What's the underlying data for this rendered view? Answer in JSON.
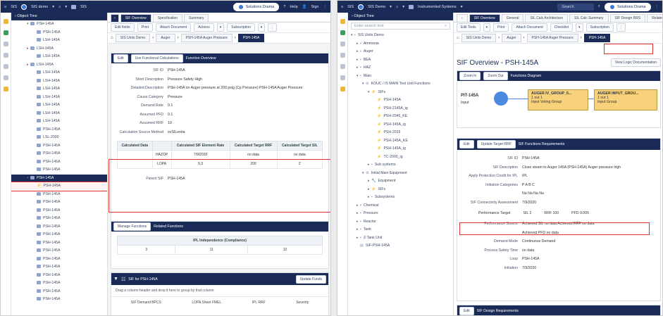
{
  "left": {
    "topbar": {
      "app_menu": "SIS",
      "project": "SIS demo",
      "home_caret": "▾",
      "unit": "SIS",
      "brand": "Solutions Drama",
      "help": "Help",
      "user": "Sign",
      "more": "⋮"
    },
    "tree": {
      "header": "Object Tree",
      "items": [
        {
          "label": "PSH-145A",
          "level": 2,
          "toggle": "▾",
          "state": ""
        },
        {
          "label": "PSH-145A",
          "level": 3,
          "toggle": "",
          "state": ""
        },
        {
          "label": "LSH-145A",
          "level": 3,
          "toggle": "",
          "state": ""
        },
        {
          "label": "LSH-145A",
          "level": 2,
          "toggle": "▸",
          "state": ""
        },
        {
          "label": "LSH-145A",
          "level": 3,
          "toggle": "",
          "state": ""
        },
        {
          "label": "LSH-145A",
          "level": 2,
          "toggle": "▸",
          "state": ""
        },
        {
          "label": "LSH-145A",
          "level": 3,
          "toggle": "",
          "state": ""
        },
        {
          "label": "LSH-145A",
          "level": 3,
          "toggle": "",
          "state": ""
        },
        {
          "label": "LSH-145A",
          "level": 3,
          "toggle": "",
          "state": ""
        },
        {
          "label": "LSH-145A",
          "level": 3,
          "toggle": "",
          "state": ""
        },
        {
          "label": "LSH-145A",
          "level": 3,
          "toggle": "",
          "state": ""
        },
        {
          "label": "LSH-145A",
          "level": 3,
          "toggle": "",
          "state": ""
        },
        {
          "label": "LSH-145A",
          "level": 3,
          "toggle": "",
          "state": ""
        },
        {
          "label": "PSH-145A",
          "level": 3,
          "toggle": "",
          "state": ""
        },
        {
          "label": "LSL-2000",
          "level": 3,
          "toggle": "",
          "state": ""
        },
        {
          "label": "PSH-145A",
          "level": 3,
          "toggle": "",
          "state": ""
        },
        {
          "label": "PSH-145A",
          "level": 3,
          "toggle": "",
          "state": ""
        },
        {
          "label": "PSH-145A",
          "level": 3,
          "toggle": "",
          "state": ""
        },
        {
          "label": "PSH-145A",
          "level": 3,
          "toggle": "",
          "state": ""
        },
        {
          "label": "PSH-145A",
          "level": 2,
          "toggle": "▾",
          "state": "sel"
        },
        {
          "label": "PSH-145A",
          "level": 3,
          "toggle": "",
          "state": "hl"
        },
        {
          "label": "PSH-145A",
          "level": 3,
          "toggle": "",
          "state": ""
        },
        {
          "label": "PSH-145A",
          "level": 3,
          "toggle": "",
          "state": ""
        },
        {
          "label": "PSH-145A",
          "level": 3,
          "toggle": "",
          "state": ""
        },
        {
          "label": "PSH-145A",
          "level": 3,
          "toggle": "",
          "state": ""
        },
        {
          "label": "PSH-145A",
          "level": 3,
          "toggle": "",
          "state": ""
        },
        {
          "label": "PSH-145A",
          "level": 3,
          "toggle": "",
          "state": ""
        },
        {
          "label": "PSH-145A",
          "level": 3,
          "toggle": "",
          "state": ""
        },
        {
          "label": "PSH-145A",
          "level": 3,
          "toggle": "",
          "state": ""
        },
        {
          "label": "PSH-145A",
          "level": 3,
          "toggle": "",
          "state": ""
        },
        {
          "label": "PSH-145A",
          "level": 3,
          "toggle": "",
          "state": ""
        },
        {
          "label": "PSH-145A",
          "level": 3,
          "toggle": "",
          "state": ""
        },
        {
          "label": "PSH-145A",
          "level": 3,
          "toggle": "",
          "state": ""
        },
        {
          "label": "PSH-145A",
          "level": 3,
          "toggle": "",
          "state": ""
        },
        {
          "label": "PSH-145A",
          "level": 3,
          "toggle": "",
          "state": ""
        }
      ]
    },
    "tabs": [
      "SIF Overview",
      "Specification",
      "Summary"
    ],
    "toolbar": {
      "edit": "Edit fields",
      "print": "Print",
      "attach": "Attach Document",
      "actions": "Actions",
      "subscription": "Subscription"
    },
    "crumbs": [
      "SIS Units Demo",
      "Auger",
      "PSH-145A Auger Pressure",
      "PSH-145A"
    ],
    "card1": {
      "buttons": [
        "Edit",
        "Use Functional Calculations"
      ],
      "title": "Function Overview",
      "fields": [
        {
          "k": "SIF ID",
          "v": "PSH-145A"
        },
        {
          "k": "Short Description",
          "v": "Pressure Safety High"
        },
        {
          "k": "Detailed Description",
          "v": "PSH-145A on Auger pressure at 200 psig (Cp Pressure) PSH-145A Auger Pressure"
        },
        {
          "k": "Cause Category",
          "v": "Pressure"
        },
        {
          "k": "Demand Rate",
          "v": "0.1"
        },
        {
          "k": "Assumed PFD",
          "v": "0.1"
        },
        {
          "k": "Assumed RRF",
          "v": "10"
        },
        {
          "k": "Calculation Source Method",
          "v": "exSILentia"
        }
      ],
      "table": {
        "headers": [
          "Calculated Data",
          "",
          "Calculated SIF Element Rate",
          "Calculated Target RRF",
          "Calculated Target SIL"
        ],
        "rows": [
          [
            "",
            "HAZOP",
            "7/9/2020",
            "no data",
            "no data"
          ],
          [
            "",
            "LOPA",
            "6.3",
            "200",
            "2"
          ]
        ]
      },
      "footer": {
        "k": "Parent SIF",
        "v": "PSH-145A"
      }
    },
    "card2": {
      "buttons": [
        "Manage Functions",
        "Related Functions"
      ],
      "table_title": "IPL Independence (Compliance)",
      "cells": [
        "3",
        "11",
        "12"
      ]
    },
    "card3": {
      "title": "SIF for PSH-145A",
      "button": "Update Funds",
      "hint": "Drag a column header and drop it here to group by that column",
      "cols": [
        "SIF Demand BPCS",
        "LOPA Sheet FMEL",
        "IPL RRF",
        "Severity"
      ]
    }
  },
  "right": {
    "topbar": {
      "app_menu": "SIS",
      "project": "SIS Demo",
      "unit": "Instrumented Systems",
      "search": "Search",
      "brand": "Solutions Drama",
      "more": "⋮"
    },
    "tree": {
      "header": "Object Tree",
      "search": "Enter search text",
      "items": [
        {
          "label": "SIS Units Demo",
          "level": 0,
          "toggle": "▾",
          "icon": "folder"
        },
        {
          "label": "Ammonia",
          "level": 1,
          "toggle": "▸",
          "icon": "folder"
        },
        {
          "label": "Auger",
          "level": 1,
          "toggle": "▸",
          "icon": "folder"
        },
        {
          "label": "BEA",
          "level": 1,
          "toggle": "▸",
          "icon": "folder"
        },
        {
          "label": "HAZ",
          "level": 1,
          "toggle": "▸",
          "icon": "folder"
        },
        {
          "label": "Main",
          "level": 1,
          "toggle": "▾",
          "icon": "folder"
        },
        {
          "label": "KOUC / IS MAIN Test Unit Functions",
          "level": 2,
          "toggle": "▾",
          "icon": "gear"
        },
        {
          "label": "SIFs",
          "level": 3,
          "toggle": "▾",
          "icon": "bolt"
        },
        {
          "label": "PSH-145A",
          "level": 4,
          "toggle": "",
          "icon": "bolt"
        },
        {
          "label": "PSH-2145A_ig",
          "level": 4,
          "toggle": "",
          "icon": "bolt"
        },
        {
          "label": "PSH-2045_KE",
          "level": 4,
          "toggle": "",
          "icon": "bolt"
        },
        {
          "label": "PSH-145A_ig",
          "level": 4,
          "toggle": "",
          "icon": "bolt"
        },
        {
          "label": "PSH-2016",
          "level": 4,
          "toggle": "",
          "icon": "bolt"
        },
        {
          "label": "PSH-145A_KE",
          "level": 4,
          "toggle": "",
          "icon": "bolt"
        },
        {
          "label": "PSH-145A_ig",
          "level": 4,
          "toggle": "",
          "icon": "bolt"
        },
        {
          "label": "TC-2000_ig",
          "level": 4,
          "toggle": "",
          "icon": "bolt"
        },
        {
          "label": "Sub systems",
          "level": 3,
          "toggle": "▸",
          "icon": "folder"
        },
        {
          "label": "Initial Main Equipment",
          "level": 2,
          "toggle": "▾",
          "icon": "gear"
        },
        {
          "label": "Equipment",
          "level": 3,
          "toggle": "▸",
          "icon": "wrench"
        },
        {
          "label": "SIFs",
          "level": 3,
          "toggle": "▸",
          "icon": "bolt"
        },
        {
          "label": "Subsystems",
          "level": 3,
          "toggle": "▸",
          "icon": "folder"
        },
        {
          "label": "Chemical",
          "level": 1,
          "toggle": "▸",
          "icon": "folder"
        },
        {
          "label": "Pressure",
          "level": 1,
          "toggle": "▸",
          "icon": "folder"
        },
        {
          "label": "Reactor",
          "level": 1,
          "toggle": "▸",
          "icon": "folder"
        },
        {
          "label": "Tank",
          "level": 1,
          "toggle": "▸",
          "icon": "folder"
        },
        {
          "label": "Z-Tank Unit",
          "level": 1,
          "toggle": "▸",
          "icon": "folder"
        },
        {
          "label": "SIF-PSH-145A",
          "level": 1,
          "toggle": "",
          "icon": "doc"
        }
      ]
    },
    "tabs": [
      "SIF Overview",
      "General",
      "SIL Calc Architecture",
      "SIL Calc Summary",
      "SIF Design RRS",
      "Related"
    ],
    "toolbar": {
      "edit": "Edit Tools",
      "print": "Print",
      "attach": "Attach Document",
      "actions": "Checklist",
      "subscription": "Subscription"
    },
    "crumbs": [
      "SIS Units Demo",
      "Auger",
      "PSH-145A Auger Pressure",
      "PSH-145A"
    ],
    "view_link": "View Logic Documentation",
    "page_title": "SIF Overview - PSH-145A",
    "diagram_toolbar": [
      "Zoom In",
      "Zoom Out"
    ],
    "diagram_title": "Functions Diagram",
    "diagram": {
      "input_tag": "PIT-145A",
      "input_label": "Input",
      "node1": {
        "title": "AUGER IV_GROUP_0...",
        "sub": "1 out 1",
        "desc": "Input Voting Group"
      },
      "node2": {
        "title": "AUGER INPUT_GROU...",
        "sub": "1 out 1",
        "desc": "Input Group"
      }
    },
    "card2": {
      "buttons": [
        "Edit",
        "Update Target RRF"
      ],
      "title": "SIF Functions Requirements",
      "fields": [
        {
          "k": "SIF ID",
          "v": "PSH-145A"
        },
        {
          "k": "SIF Description",
          "v": "Close steam to Auger 145A (PSH-145A) Auger pressure high"
        },
        {
          "k": "Apply Protection Credit for IPL",
          "v": "IPL"
        },
        {
          "k": "Initiation Categories",
          "v": "P   A   B   C"
        },
        {
          "k": "",
          "v": "Na   Na   Na   Na"
        },
        {
          "k": "SIF Connectivity Assessment",
          "v": "7/9/2020"
        }
      ],
      "performance": {
        "label": "Performance Target",
        "sil": "SIL 2",
        "rrf": "RRF 100",
        "pfd": "PFD 0.005"
      },
      "fields2": [
        {
          "k": "Performance Source",
          "v": "Achieved SIL no data    Achieved RRF no data"
        },
        {
          "k": "",
          "v": "Achieved PFD no data"
        },
        {
          "k": "Demand Mode",
          "v": "Continuous Demand"
        },
        {
          "k": "Process Safety Time",
          "v": "no data"
        },
        {
          "k": "Loop",
          "v": "PSH-145A"
        },
        {
          "k": "Initiation",
          "v": "7/9/2020"
        }
      ]
    },
    "card3": {
      "buttons": [
        "Edit"
      ],
      "title": "SIF Design Requirements"
    }
  }
}
